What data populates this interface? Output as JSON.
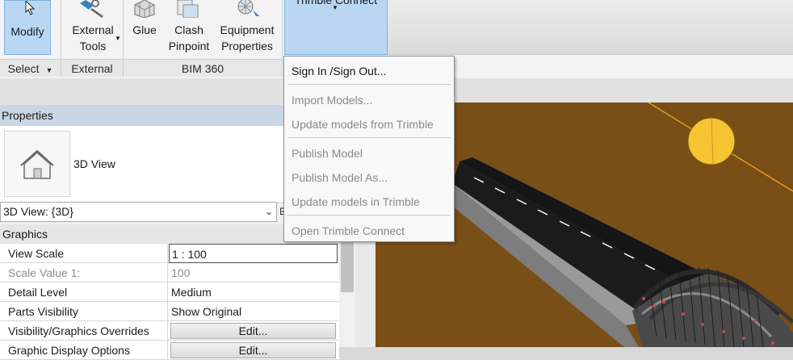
{
  "ribbon": {
    "modify_label": "Modify",
    "external_tools_label": [
      "External",
      "Tools"
    ],
    "glue_label": "Glue",
    "clash_pinpoint_label": [
      "Clash",
      "Pinpoint"
    ],
    "equipment_properties_label": [
      "Equipment",
      "Properties"
    ],
    "trimble_connect_label": "Trimble Connect",
    "panels": {
      "select": "Select",
      "external": "External",
      "bim360": "BIM 360"
    },
    "icons": [
      "modify-cursor-icon",
      "external-tools-icon",
      "glue-icon",
      "clash-pinpoint-icon",
      "equipment-properties-icon"
    ]
  },
  "trimble_menu": {
    "items": [
      {
        "label": "Sign In /Sign Out...",
        "enabled": true
      },
      {
        "label": "Import Models...",
        "enabled": false
      },
      {
        "label": "Update models from Trimble",
        "enabled": false
      },
      {
        "label": "Publish Model",
        "enabled": false
      },
      {
        "label": "Publish Model As...",
        "enabled": false
      },
      {
        "label": "Update models in Trimble",
        "enabled": false
      },
      {
        "label": "Open Trimble Connect",
        "enabled": false
      }
    ]
  },
  "properties": {
    "header": "Properties",
    "type_name": "3D View",
    "type_selector_value": "3D View: {3D}",
    "section": "Graphics",
    "rows": [
      {
        "name": "View Scale",
        "value": "1 : 100"
      },
      {
        "name": "Scale Value    1:",
        "value": "100"
      },
      {
        "name": "Detail Level",
        "value": "Medium"
      },
      {
        "name": "Parts Visibility",
        "value": "Show Original"
      },
      {
        "name": "Visibility/Graphics Overrides",
        "value": "Edit..."
      },
      {
        "name": "Graphic Display Options",
        "value": "Edit..."
      }
    ]
  },
  "colors": {
    "accent_blue": "#b9d7f3",
    "ground": "#7a4e17",
    "sun": "#f6c333",
    "road": "#1a1a1a"
  }
}
